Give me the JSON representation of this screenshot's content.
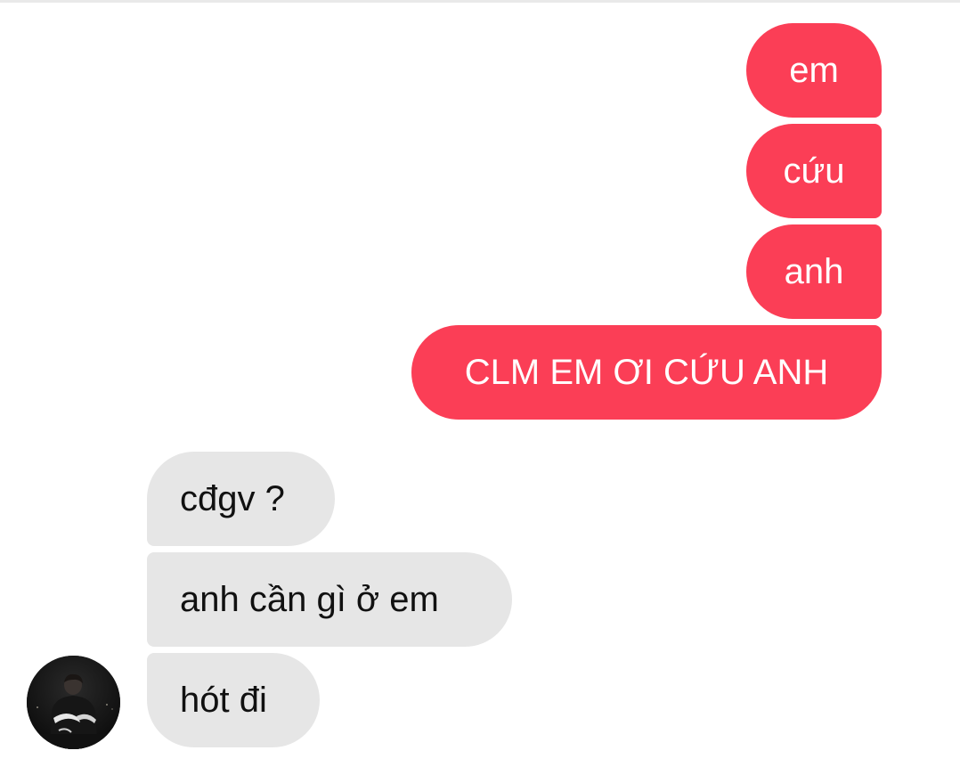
{
  "chat": {
    "outgoing": [
      {
        "text": "em"
      },
      {
        "text": "cứu"
      },
      {
        "text": "anh"
      },
      {
        "text": "CLM EM ƠI CỨU ANH"
      }
    ],
    "incoming": [
      {
        "text": "cđgv ?"
      },
      {
        "text": "anh cần gì ở em"
      },
      {
        "text": "hót đi"
      }
    ]
  },
  "colors": {
    "outgoing_bubble": "#fb3e56",
    "incoming_bubble": "#e6e6e6",
    "background": "#ffffff"
  },
  "avatar": {
    "icon": "profile-photo-avatar"
  }
}
